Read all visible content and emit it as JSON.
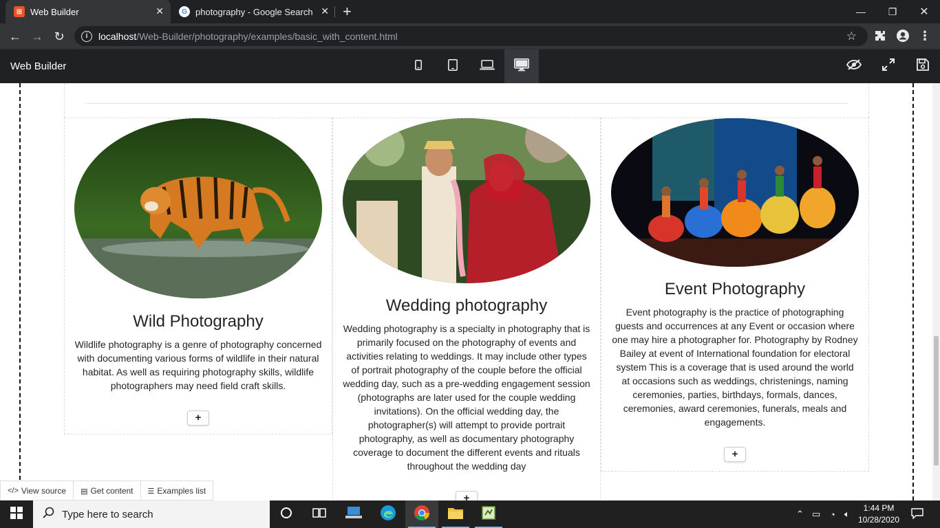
{
  "browser": {
    "tabs": [
      {
        "title": "Web Builder",
        "favicon": "web-builder-favicon",
        "active": true
      },
      {
        "title": "photography - Google Search",
        "favicon": "google-favicon",
        "active": false
      }
    ],
    "url_host": "localhost",
    "url_path": "/Web-Builder/photography/examples/basic_with_content.html"
  },
  "app": {
    "title": "Web Builder",
    "devices": [
      "mobile-icon",
      "tablet-icon",
      "laptop-icon",
      "desktop-icon"
    ],
    "active_device": "desktop"
  },
  "columns": [
    {
      "heading": "Wild Photography",
      "text": "Wildlife photography is a genre of photography concerned with documenting various forms of wildlife in their natural habitat. As well as requiring photography skills, wildlife photographers may need field craft skills.",
      "add_label": "+"
    },
    {
      "heading": "Wedding photography",
      "text": "Wedding photography is a specialty in photography that is primarily focused on the photography of events and activities relating to weddings. It may include other types of portrait photography of the couple before the official wedding day, such as a pre-wedding engagement session (photographs are later used for the couple wedding invitations). On the official wedding day, the photographer(s) will attempt to provide portrait photography, as well as documentary photography coverage to document the different events and rituals throughout the wedding day",
      "add_label": "+"
    },
    {
      "heading": "Event Photography",
      "text": "Event photography is the practice of photographing guests and occurrences at any Event or occasion where one may hire a photographer for. Photography by Rodney Bailey at event of International foundation for electoral system This is a coverage that is used around the world at occasions such as weddings, christenings, naming ceremonies, parties, birthdays, formals, dances, ceremonies, award ceremonies, funerals, meals and engagements.",
      "add_label": "+"
    }
  ],
  "bottom_bar": {
    "view_source": "View source",
    "get_content": "Get content",
    "examples_list": "Examples list"
  },
  "taskbar": {
    "search_placeholder": "Type here to search",
    "time": "1:44 PM",
    "date": "10/28/2020"
  },
  "colors": {
    "chrome_dark": "#202124",
    "toolbar": "#35363a",
    "accent_blue": "#76b9ed"
  }
}
